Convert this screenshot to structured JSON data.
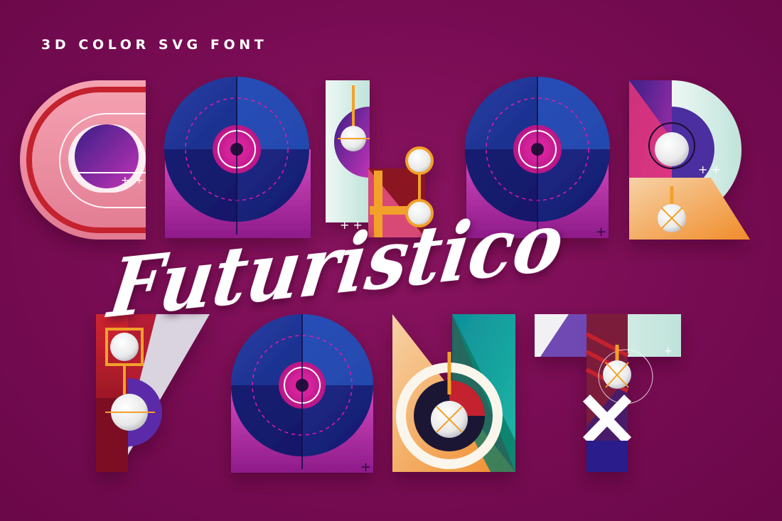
{
  "header": {
    "tagline": "3D COLOR SVG FONT"
  },
  "showcase": {
    "script_word": "Futuristico",
    "row1_letters": [
      "C",
      "O",
      "L",
      "O",
      "R"
    ],
    "row2_letters": [
      "F",
      "O",
      "N",
      "T"
    ]
  },
  "colors": {
    "background": "#7a0c55",
    "navy": "#1c2a8a",
    "deep_navy": "#151667",
    "magenta": "#e01aa8",
    "pink": "#f08ba0",
    "red": "#c4202e",
    "orange": "#f2a12c",
    "mint": "#d6efe8",
    "teal": "#13a39d",
    "white": "#ffffff"
  }
}
